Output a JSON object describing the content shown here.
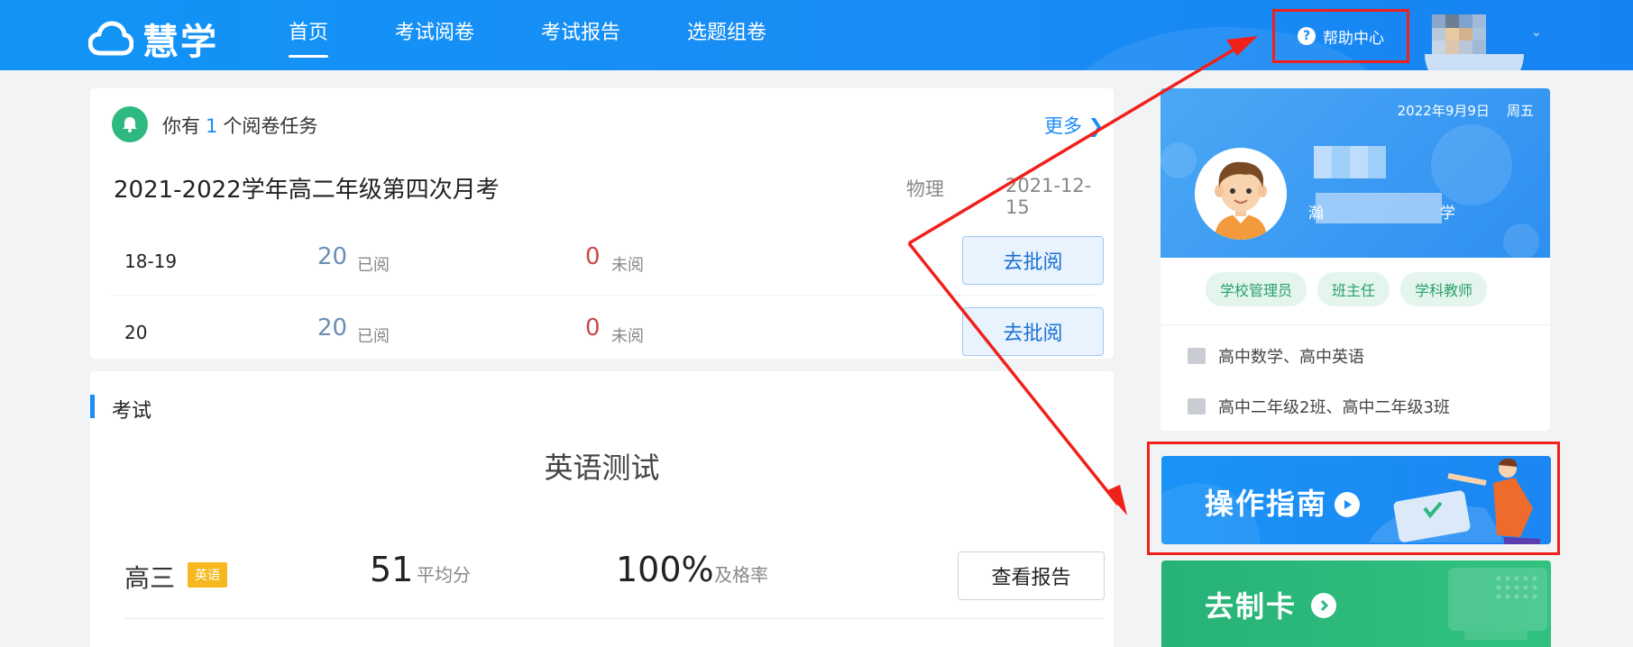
{
  "header": {
    "logo_text": "慧学",
    "nav": [
      {
        "label": "首页",
        "active": true
      },
      {
        "label": "考试阅卷",
        "active": false
      },
      {
        "label": "考试报告",
        "active": false
      },
      {
        "label": "选题组卷",
        "active": false
      }
    ],
    "help_label": "帮助中心",
    "help_icon": "?"
  },
  "task": {
    "prefix": "你有",
    "count": "1",
    "suffix": "个阅卷任务",
    "more_label": "更多",
    "exam_title": "2021-2022学年高二年级第四次月考",
    "subject": "物理",
    "date": "2021-12-15",
    "rows": [
      {
        "questions": "18-19",
        "read": "20",
        "read_label": "已阅",
        "unread": "0",
        "unread_label": "未阅",
        "action": "去批阅"
      },
      {
        "questions": "20",
        "read": "20",
        "read_label": "已阅",
        "unread": "0",
        "unread_label": "未阅",
        "action": "去批阅"
      }
    ]
  },
  "exam": {
    "section_title": "考试",
    "name": "英语测试",
    "grade": "高三",
    "subject_tag": "英语",
    "avg_score": "51",
    "avg_label": "平均分",
    "pass_rate": "100%",
    "pass_label": "及格率",
    "report_button": "查看报告"
  },
  "profile": {
    "date": "2022年9月9日",
    "weekday": "周五",
    "school_start": "瀚",
    "school_end": "学",
    "roles": [
      "学校管理员",
      "班主任",
      "学科教师"
    ],
    "subjects": "高中数学、高中英语",
    "classes": "高中二年级2班、高中二年级3班"
  },
  "banners": {
    "guide": "操作指南",
    "card": "去制卡"
  },
  "colors": {
    "brand": "#1a8cf5",
    "annotation_red": "#f0201a",
    "green": "#2db97f"
  }
}
